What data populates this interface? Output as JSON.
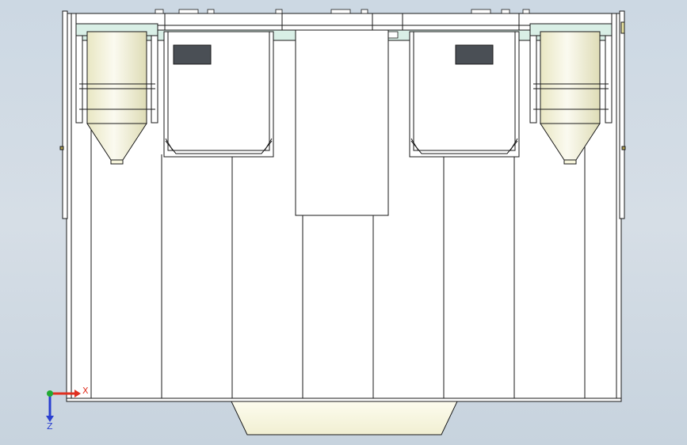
{
  "viewport": {
    "background_top": "#ccd8e3",
    "background_bottom": "#c7d3de"
  },
  "colors": {
    "line": "#1a1a1a",
    "panel_fill": "#ffffff",
    "rail_fill": "#d9efe6",
    "hopper_fill": "#f7f5dc",
    "tray_fill": "#fbfae8",
    "window_fill": "#4a4f55",
    "x_axis": "#e03020",
    "y_axis": "#22aa33",
    "z_axis": "#2a3fd0"
  },
  "triad": {
    "x_label": "X",
    "z_label": "Z"
  }
}
